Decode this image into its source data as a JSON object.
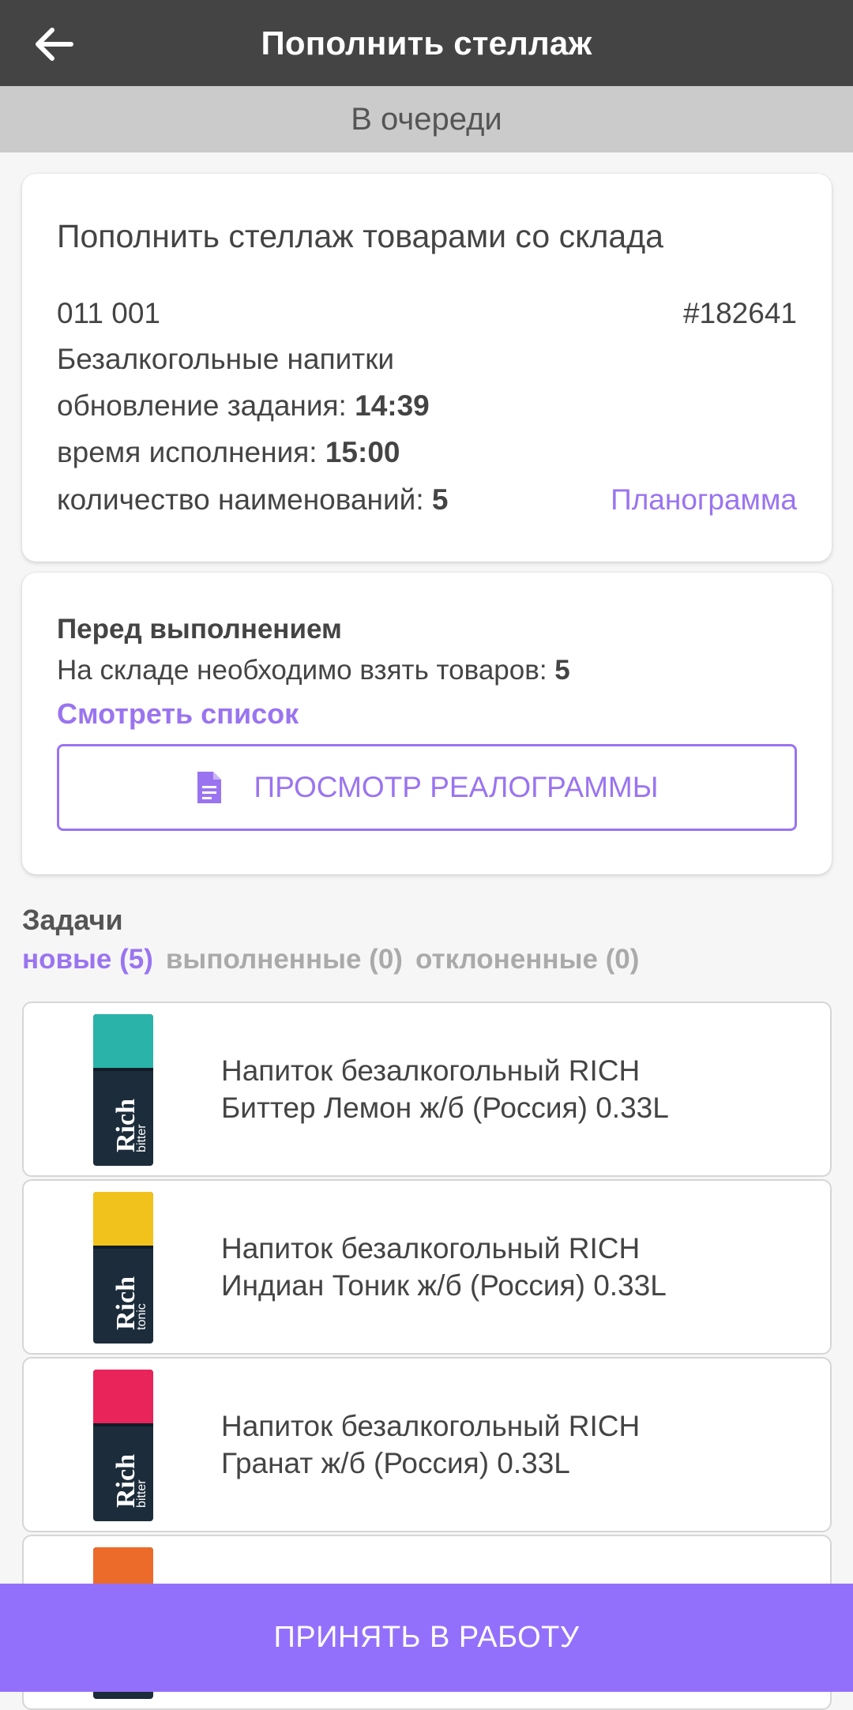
{
  "header": {
    "title": "Пополнить стеллаж"
  },
  "status": "В очереди",
  "task_card": {
    "title": "Пополнить стеллаж товарами со склада",
    "rack": "011 001",
    "number": "#182641",
    "category": "Безалкогольные напитки",
    "update_label": "обновление задания: ",
    "update_time": "14:39",
    "due_label": "время исполнения: ",
    "due_time": "15:00",
    "count_label": "количество наименований: ",
    "count": "5",
    "planogram_link": "Планограмма"
  },
  "before_card": {
    "heading": "Перед выполнением",
    "text": "На складе необходимо взять товаров: ",
    "count": "5",
    "link": "Смотреть список",
    "button_label": "ПРОСМОТР РЕАЛОГРАММЫ",
    "button_icon": "document-icon"
  },
  "tasks": {
    "heading": "Задачи",
    "tabs": [
      {
        "label": "новые (5)",
        "active": true
      },
      {
        "label": "выполненные (0)",
        "active": false
      },
      {
        "label": "отклоненные (0)",
        "active": false
      }
    ],
    "items": [
      {
        "name": "Напиток безалкогольный RICH\nБиттер Лемон ж/б (Россия) 0.33L",
        "brand": "Rich",
        "flavor": "bitter",
        "top_color": "#2ab3a8"
      },
      {
        "name": "Напиток безалкогольный RICH\nИндиан Тоник ж/б (Россия) 0.33L",
        "brand": "Rich",
        "flavor": "tonic",
        "top_color": "#f2c21c"
      },
      {
        "name": "Напиток безалкогольный RICH\nГранат ж/б (Россия) 0.33L",
        "brand": "Rich",
        "flavor": "bitter",
        "top_color": "#e8245a"
      },
      {
        "name": "",
        "brand": "Rich",
        "flavor": "",
        "top_color": "#ec6a2a"
      }
    ]
  },
  "primary_button": "ПРИНЯТЬ В РАБОТУ",
  "colors": {
    "appbar": "#444444",
    "accent": "#9a74f0",
    "primary_button": "#9370fb"
  }
}
